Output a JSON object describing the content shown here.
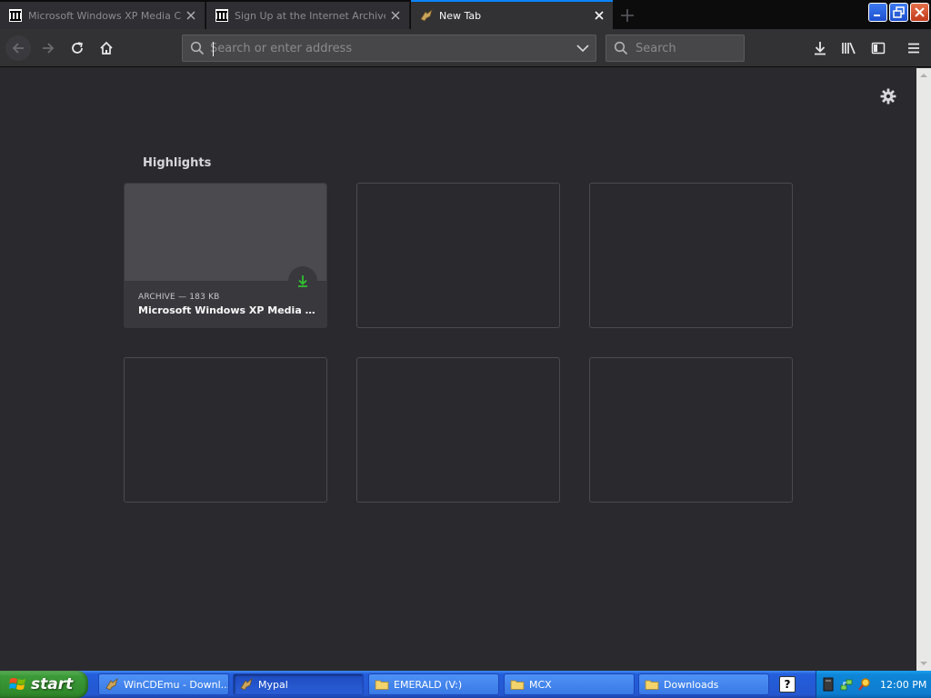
{
  "tabs": [
    {
      "title": "Microsoft Windows XP Media Cent",
      "icon": "archive-icon",
      "active": false
    },
    {
      "title": "Sign Up at the Internet Archive",
      "icon": "archive-icon",
      "active": false
    },
    {
      "title": "New Tab",
      "icon": "mypal-icon",
      "active": true
    }
  ],
  "navbar": {
    "url_placeholder": "Search or enter address",
    "search_placeholder": "Search"
  },
  "highlights": {
    "title": "Highlights",
    "cards": [
      {
        "meta": "ARCHIVE — 183 KB",
        "title": "Microsoft Windows XP Media C..."
      }
    ]
  },
  "taskbar": {
    "start_label": "start",
    "tasks": [
      {
        "label": "WinCDEmu - Downl...",
        "icon": "mypal-icon",
        "active": false
      },
      {
        "label": "Mypal",
        "icon": "mypal-icon",
        "active": true
      },
      {
        "label": "EMERALD (V:)",
        "icon": "folder-icon",
        "active": false
      },
      {
        "label": "MCX",
        "icon": "folder-icon",
        "active": false
      },
      {
        "label": "Downloads",
        "icon": "folder-icon",
        "active": false
      }
    ],
    "help_label": "?",
    "clock": "12:00 PM"
  },
  "colors": {
    "accent": "#0a84ff",
    "content_bg": "#2a2a2e",
    "download_badge": "#30c030"
  }
}
